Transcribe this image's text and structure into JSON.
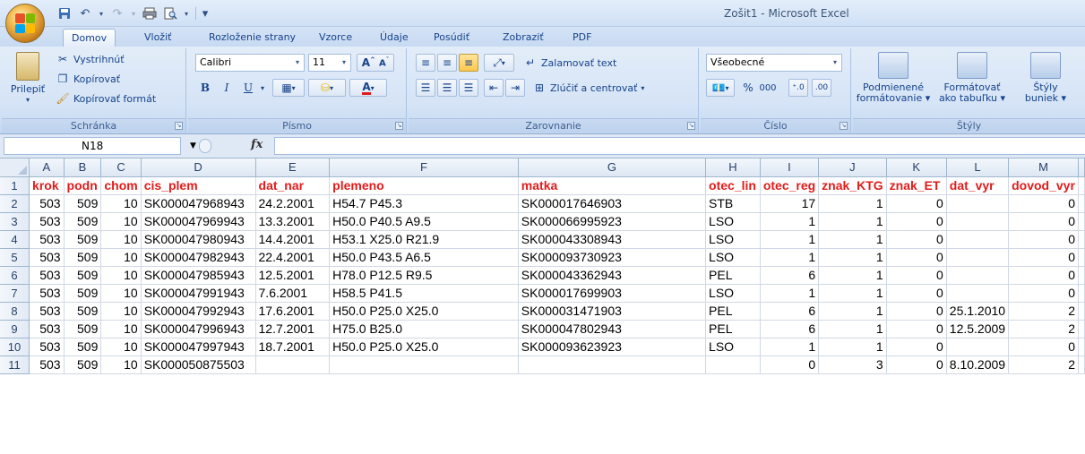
{
  "window": {
    "title": "Zošit1 - Microsoft Excel"
  },
  "quick_access": [
    "save-icon",
    "undo-icon",
    "redo-icon",
    "print-icon",
    "print-preview-icon",
    "customize-icon"
  ],
  "tabs": [
    {
      "label": "Domov",
      "active": true
    },
    {
      "label": "Vložiť",
      "active": false
    },
    {
      "label": "Rozloženie strany",
      "active": false
    },
    {
      "label": "Vzorce",
      "active": false
    },
    {
      "label": "Údaje",
      "active": false
    },
    {
      "label": "Posúdiť",
      "active": false
    },
    {
      "label": "Zobraziť",
      "active": false
    },
    {
      "label": "PDF",
      "active": false
    }
  ],
  "ribbon": {
    "clipboard": {
      "label": "Schránka",
      "paste": "Prilepiť",
      "cut": "Vystrihnúť",
      "copy": "Kopírovať",
      "format_painter": "Kopírovať formát"
    },
    "font": {
      "label": "Písmo",
      "font_name": "Calibri",
      "font_size": "11",
      "bold": "B",
      "italic": "I",
      "underline": "U"
    },
    "alignment": {
      "label": "Zarovnanie",
      "wrap": "Zalamovať text",
      "merge": "Zlúčiť a centrovať"
    },
    "number": {
      "label": "Číslo",
      "format": "Všeobecné",
      "percent": "%",
      "thousands": "000"
    },
    "styles": {
      "label": "Štýly",
      "conditional": "Podmienené",
      "conditional2": "formátovanie",
      "table": "Formátovať",
      "table2": "ako tabuľku",
      "cell": "Štýly",
      "cell2": "buniek"
    }
  },
  "formula_bar": {
    "name_box": "N18",
    "fx": "fx",
    "value": ""
  },
  "sheet": {
    "columns": [
      "A",
      "B",
      "C",
      "D",
      "E",
      "F",
      "G",
      "H",
      "I",
      "J",
      "K",
      "L",
      "M"
    ],
    "header_row": [
      "krok",
      "podn",
      "chom",
      "cis_plem",
      "dat_nar",
      "plemeno",
      "matka",
      "otec_lin",
      "otec_reg",
      "znak_KTG",
      "znak_ET",
      "dat_vyr",
      "dovod_vyr"
    ],
    "rows": [
      [
        "503",
        "509",
        "10",
        "SK000047968943",
        "24.2.2001",
        "H54.7  P45.3",
        "SK000017646903",
        "STB",
        "17",
        "1",
        "0",
        "",
        "0"
      ],
      [
        "503",
        "509",
        "10",
        "SK000047969943",
        "13.3.2001",
        "H50.0  P40.5  A9.5",
        "SK000066995923",
        "LSO",
        "1",
        "1",
        "0",
        "",
        "0"
      ],
      [
        "503",
        "509",
        "10",
        "SK000047980943",
        "14.4.2001",
        "H53.1  X25.0  R21.9",
        "SK000043308943",
        "LSO",
        "1",
        "1",
        "0",
        "",
        "0"
      ],
      [
        "503",
        "509",
        "10",
        "SK000047982943",
        "22.4.2001",
        "H50.0  P43.5  A6.5",
        "SK000093730923",
        "LSO",
        "1",
        "1",
        "0",
        "",
        "0"
      ],
      [
        "503",
        "509",
        "10",
        "SK000047985943",
        "12.5.2001",
        "H78.0  P12.5  R9.5",
        "SK000043362943",
        "PEL",
        "6",
        "1",
        "0",
        "",
        "0"
      ],
      [
        "503",
        "509",
        "10",
        "SK000047991943",
        "7.6.2001",
        "H58.5  P41.5",
        "SK000017699903",
        "LSO",
        "1",
        "1",
        "0",
        "",
        "0"
      ],
      [
        "503",
        "509",
        "10",
        "SK000047992943",
        "17.6.2001",
        "H50.0  P25.0  X25.0",
        "SK000031471903",
        "PEL",
        "6",
        "1",
        "0",
        "25.1.2010",
        "2"
      ],
      [
        "503",
        "509",
        "10",
        "SK000047996943",
        "12.7.2001",
        "H75.0  B25.0",
        "SK000047802943",
        "PEL",
        "6",
        "1",
        "0",
        "12.5.2009",
        "2"
      ],
      [
        "503",
        "509",
        "10",
        "SK000047997943",
        "18.7.2001",
        "H50.0  P25.0  X25.0",
        "SK000093623923",
        "LSO",
        "1",
        "1",
        "0",
        "",
        "0"
      ],
      [
        "503",
        "509",
        "10",
        "SK000050875503",
        "",
        "",
        "",
        "",
        "0",
        "3",
        "0",
        "8.10.2009",
        "2"
      ]
    ],
    "numeric_columns": [
      0,
      1,
      2,
      8,
      9,
      10,
      12
    ]
  }
}
